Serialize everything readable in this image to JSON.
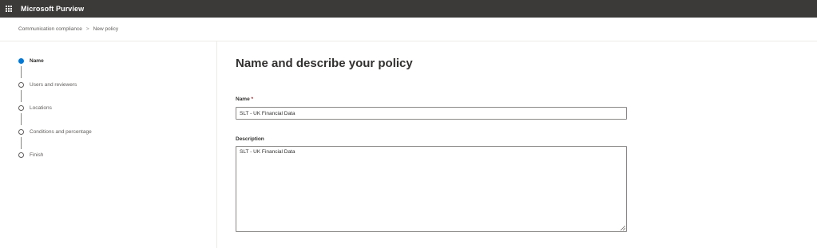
{
  "app": {
    "title": "Microsoft Purview",
    "waffle_icon": "app-launcher-icon"
  },
  "breadcrumb": {
    "items": [
      "Communication compliance",
      "New policy"
    ],
    "separator": ">"
  },
  "steps": [
    {
      "label": "Name",
      "active": true
    },
    {
      "label": "Users and reviewers",
      "active": false
    },
    {
      "label": "Locations",
      "active": false
    },
    {
      "label": "Conditions and percentage",
      "active": false
    },
    {
      "label": "Finish",
      "active": false
    }
  ],
  "form": {
    "title": "Name and describe your policy",
    "name_label": "Name",
    "required_marker": "*",
    "name_value": "SLT - UK Financial Data",
    "description_label": "Description",
    "description_value": "SLT - UK Financial Data"
  },
  "colors": {
    "topbar": "#3b3a39",
    "accent": "#0078d4",
    "required": "#a4262c"
  }
}
